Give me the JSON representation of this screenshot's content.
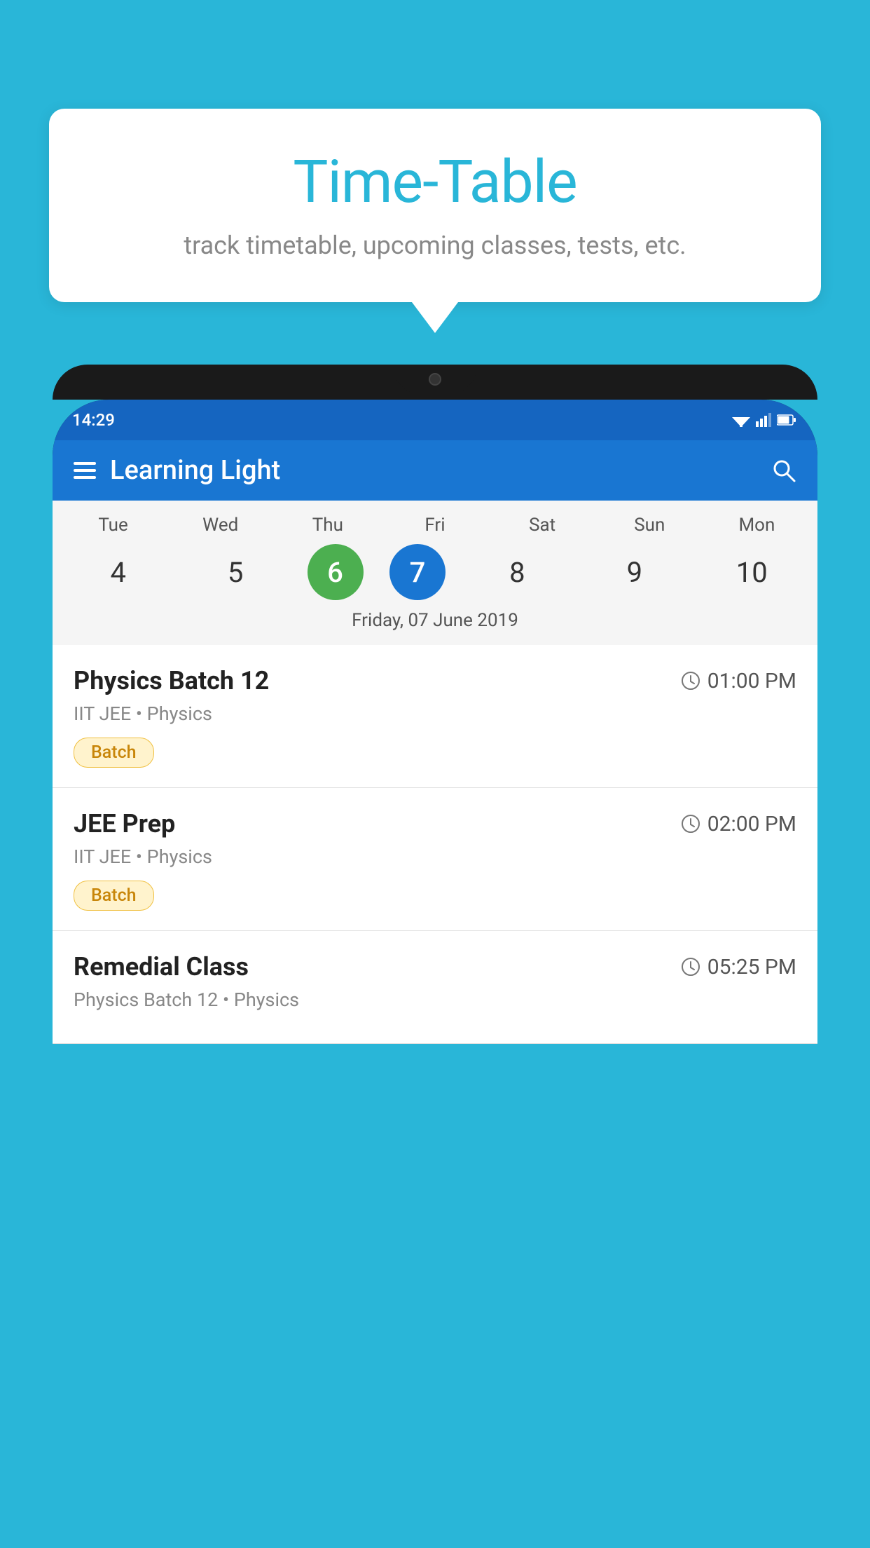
{
  "background_color": "#29B6D8",
  "speech_bubble": {
    "title": "Time-Table",
    "subtitle": "track timetable, upcoming classes, tests, etc."
  },
  "phone": {
    "status_bar": {
      "time": "14:29"
    },
    "app_bar": {
      "title": "Learning Light"
    },
    "calendar": {
      "days": [
        {
          "short": "Tue",
          "num": "4"
        },
        {
          "short": "Wed",
          "num": "5"
        },
        {
          "short": "Thu",
          "num": "6",
          "state": "today"
        },
        {
          "short": "Fri",
          "num": "7",
          "state": "selected"
        },
        {
          "short": "Sat",
          "num": "8"
        },
        {
          "short": "Sun",
          "num": "9"
        },
        {
          "short": "Mon",
          "num": "10"
        }
      ],
      "selected_date_label": "Friday, 07 June 2019"
    },
    "schedule": [
      {
        "class_name": "Physics Batch 12",
        "time": "01:00 PM",
        "subtitle": "IIT JEE • Physics",
        "badge": "Batch"
      },
      {
        "class_name": "JEE Prep",
        "time": "02:00 PM",
        "subtitle": "IIT JEE • Physics",
        "badge": "Batch"
      },
      {
        "class_name": "Remedial Class",
        "time": "05:25 PM",
        "subtitle": "Physics Batch 12 • Physics",
        "badge": null
      }
    ]
  }
}
